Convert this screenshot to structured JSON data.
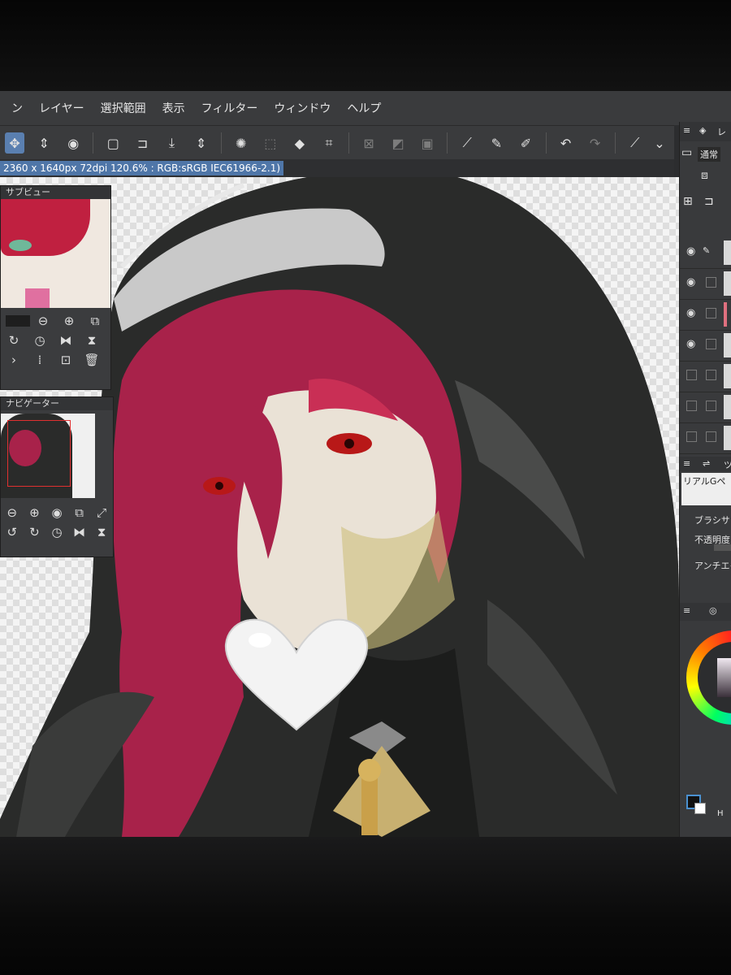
{
  "menu": [
    "ン",
    "レイヤー",
    "選択範囲",
    "表示",
    "フィルター",
    "ウィンドウ",
    "ヘルプ"
  ],
  "toolbar_icons": [
    "move-icon",
    "updown-icon",
    "app-icon",
    "new-file-icon",
    "open-folder-icon",
    "save-icon",
    "updown-icon",
    "spinner-icon",
    "transform-icon",
    "fill-icon",
    "crop-icon",
    "clear-selection-icon",
    "gradient-icon",
    "select-all-icon",
    "draw-line-icon",
    "brush-icon",
    "pen-icon",
    "undo-icon",
    "redo-icon",
    "eyedropper-icon"
  ],
  "info_bar": "2360 x 1640px 72dpi 120.6% : RGB:sRGB IEC61966-2.1)",
  "subview": {
    "title": "サブビュー"
  },
  "navigator": {
    "title": "ナビゲーター"
  },
  "layer_panel": {
    "title": "レ",
    "blend_mode": "通常"
  },
  "tool_property": {
    "title": "ツ",
    "brush_name": "リアルGペ",
    "labels": [
      "ブラシサ",
      "不透明度",
      "アンチエイ"
    ]
  },
  "colors": {
    "accent": "#5a7fb0",
    "hair": "#a8224a",
    "robe": "#2a2b2a",
    "bg": "#2c2d2f"
  }
}
